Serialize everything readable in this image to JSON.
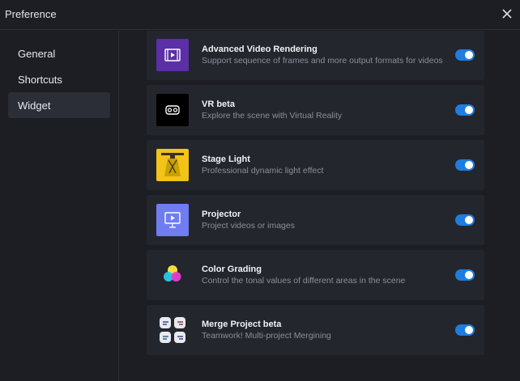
{
  "window": {
    "title": "Preference",
    "close_icon": "close-icon"
  },
  "sidebar": {
    "items": [
      {
        "label": "General",
        "active": false
      },
      {
        "label": "Shortcuts",
        "active": false
      },
      {
        "label": "Widget",
        "active": true
      }
    ]
  },
  "widgets": [
    {
      "title": "Advanced Video Rendering",
      "desc": "Support sequence of frames and more output formats for videos",
      "icon": "film-icon",
      "enabled": true
    },
    {
      "title": "VR beta",
      "desc": "Explore the scene with Virtual Reality",
      "icon": "vr-headset-icon",
      "enabled": true
    },
    {
      "title": "Stage Light",
      "desc": "Professional dynamic light effect",
      "icon": "stage-light-icon",
      "enabled": true
    },
    {
      "title": "Projector",
      "desc": "Project videos or images",
      "icon": "projector-icon",
      "enabled": true
    },
    {
      "title": "Color Grading",
      "desc": "Control the tonal values of different areas in the scene",
      "icon": "color-circles-icon",
      "enabled": true
    },
    {
      "title": "Merge Project beta",
      "desc": "Teamwork! Multi-project Mergining",
      "icon": "merge-hands-icon",
      "enabled": true
    }
  ],
  "colors": {
    "accent": "#1e7de0",
    "background": "#1c1e24",
    "card": "#23262d"
  }
}
